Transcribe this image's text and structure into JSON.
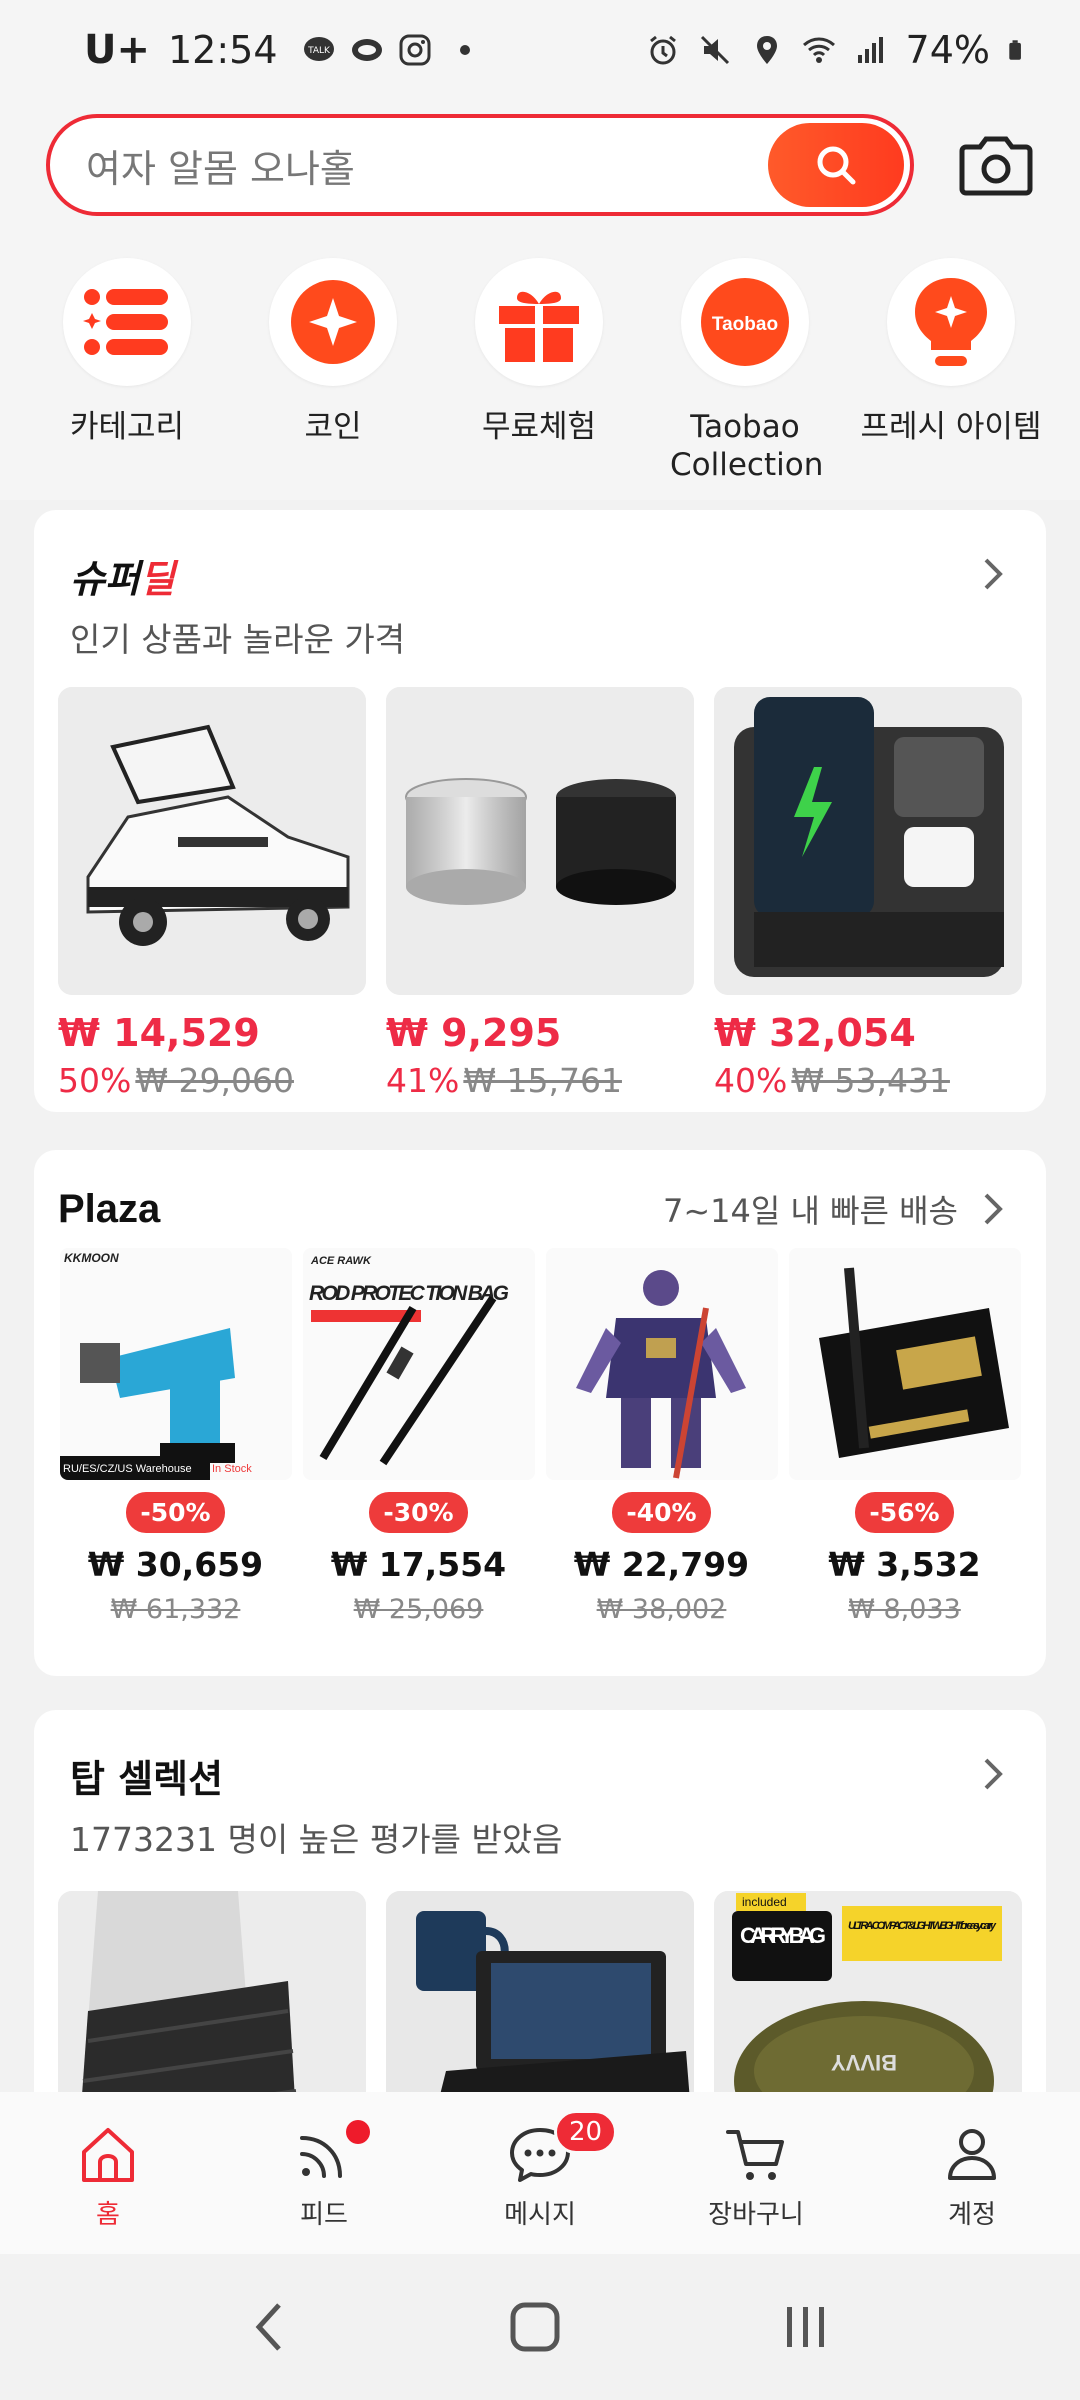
{
  "status_bar": {
    "carrier": "U+",
    "time": "12:54",
    "battery": "74%"
  },
  "search": {
    "placeholder": "여자 알몸 오나홀"
  },
  "categories": [
    {
      "label": "카테고리",
      "icon": "list-icon"
    },
    {
      "label": "코인",
      "icon": "coin-icon"
    },
    {
      "label": "무료체험",
      "icon": "gift-icon"
    },
    {
      "label": "Taobao Collection",
      "icon": "taobao-icon",
      "icon_text": "Taobao"
    },
    {
      "label": "프레시 아이템",
      "icon": "lightbulb-icon"
    }
  ],
  "super_deal": {
    "title_black": "슈퍼",
    "title_red": "딜",
    "subtitle": "인기 상품과 놀라운 가격",
    "items": [
      {
        "price": "₩ 14,529",
        "discount": "50%",
        "original": "₩ 29,060"
      },
      {
        "price": "₩ 9,295",
        "discount": "41%",
        "original": "₩ 15,761"
      },
      {
        "price": "₩ 32,054",
        "discount": "40%",
        "original": "₩ 53,431"
      }
    ]
  },
  "plaza": {
    "title": "Plaza",
    "delivery": "7~14일 내 빠른 배송",
    "items": [
      {
        "badge": "-50%",
        "price": "₩ 30,659",
        "original": "₩ 61,332",
        "img_brand": "KKMOON",
        "img_text": "RU/ES/CZ/US Warehouse",
        "img_text2": "In Stock"
      },
      {
        "badge": "-30%",
        "price": "₩ 17,554",
        "original": "₩ 25,069",
        "img_brand": "ACE RAWK",
        "img_text": "ROD PROTEC TION BAG"
      },
      {
        "badge": "-40%",
        "price": "₩ 22,799",
        "original": "₩ 38,002"
      },
      {
        "badge": "-56%",
        "price": "₩ 3,532",
        "original": "₩ 8,033"
      }
    ]
  },
  "top_selection": {
    "title": "탑 셀렉션",
    "subtitle": "1773231 명이 높은 평가를 받았음",
    "item3_badge": "included",
    "item3_text1": "CARRY BAG",
    "item3_text2": "ULTRA-COMPACT &LIGHTWEIGHT for easy carry"
  },
  "bottom_nav": [
    {
      "label": "홈",
      "icon": "home-icon",
      "active": true
    },
    {
      "label": "피드",
      "icon": "feed-icon"
    },
    {
      "label": "메시지",
      "icon": "message-icon",
      "count": "20"
    },
    {
      "label": "장바구니",
      "icon": "cart-icon"
    },
    {
      "label": "계정",
      "icon": "account-icon"
    }
  ],
  "colors": {
    "accent": "#ee2b36",
    "price_red": "#ee2b46"
  }
}
